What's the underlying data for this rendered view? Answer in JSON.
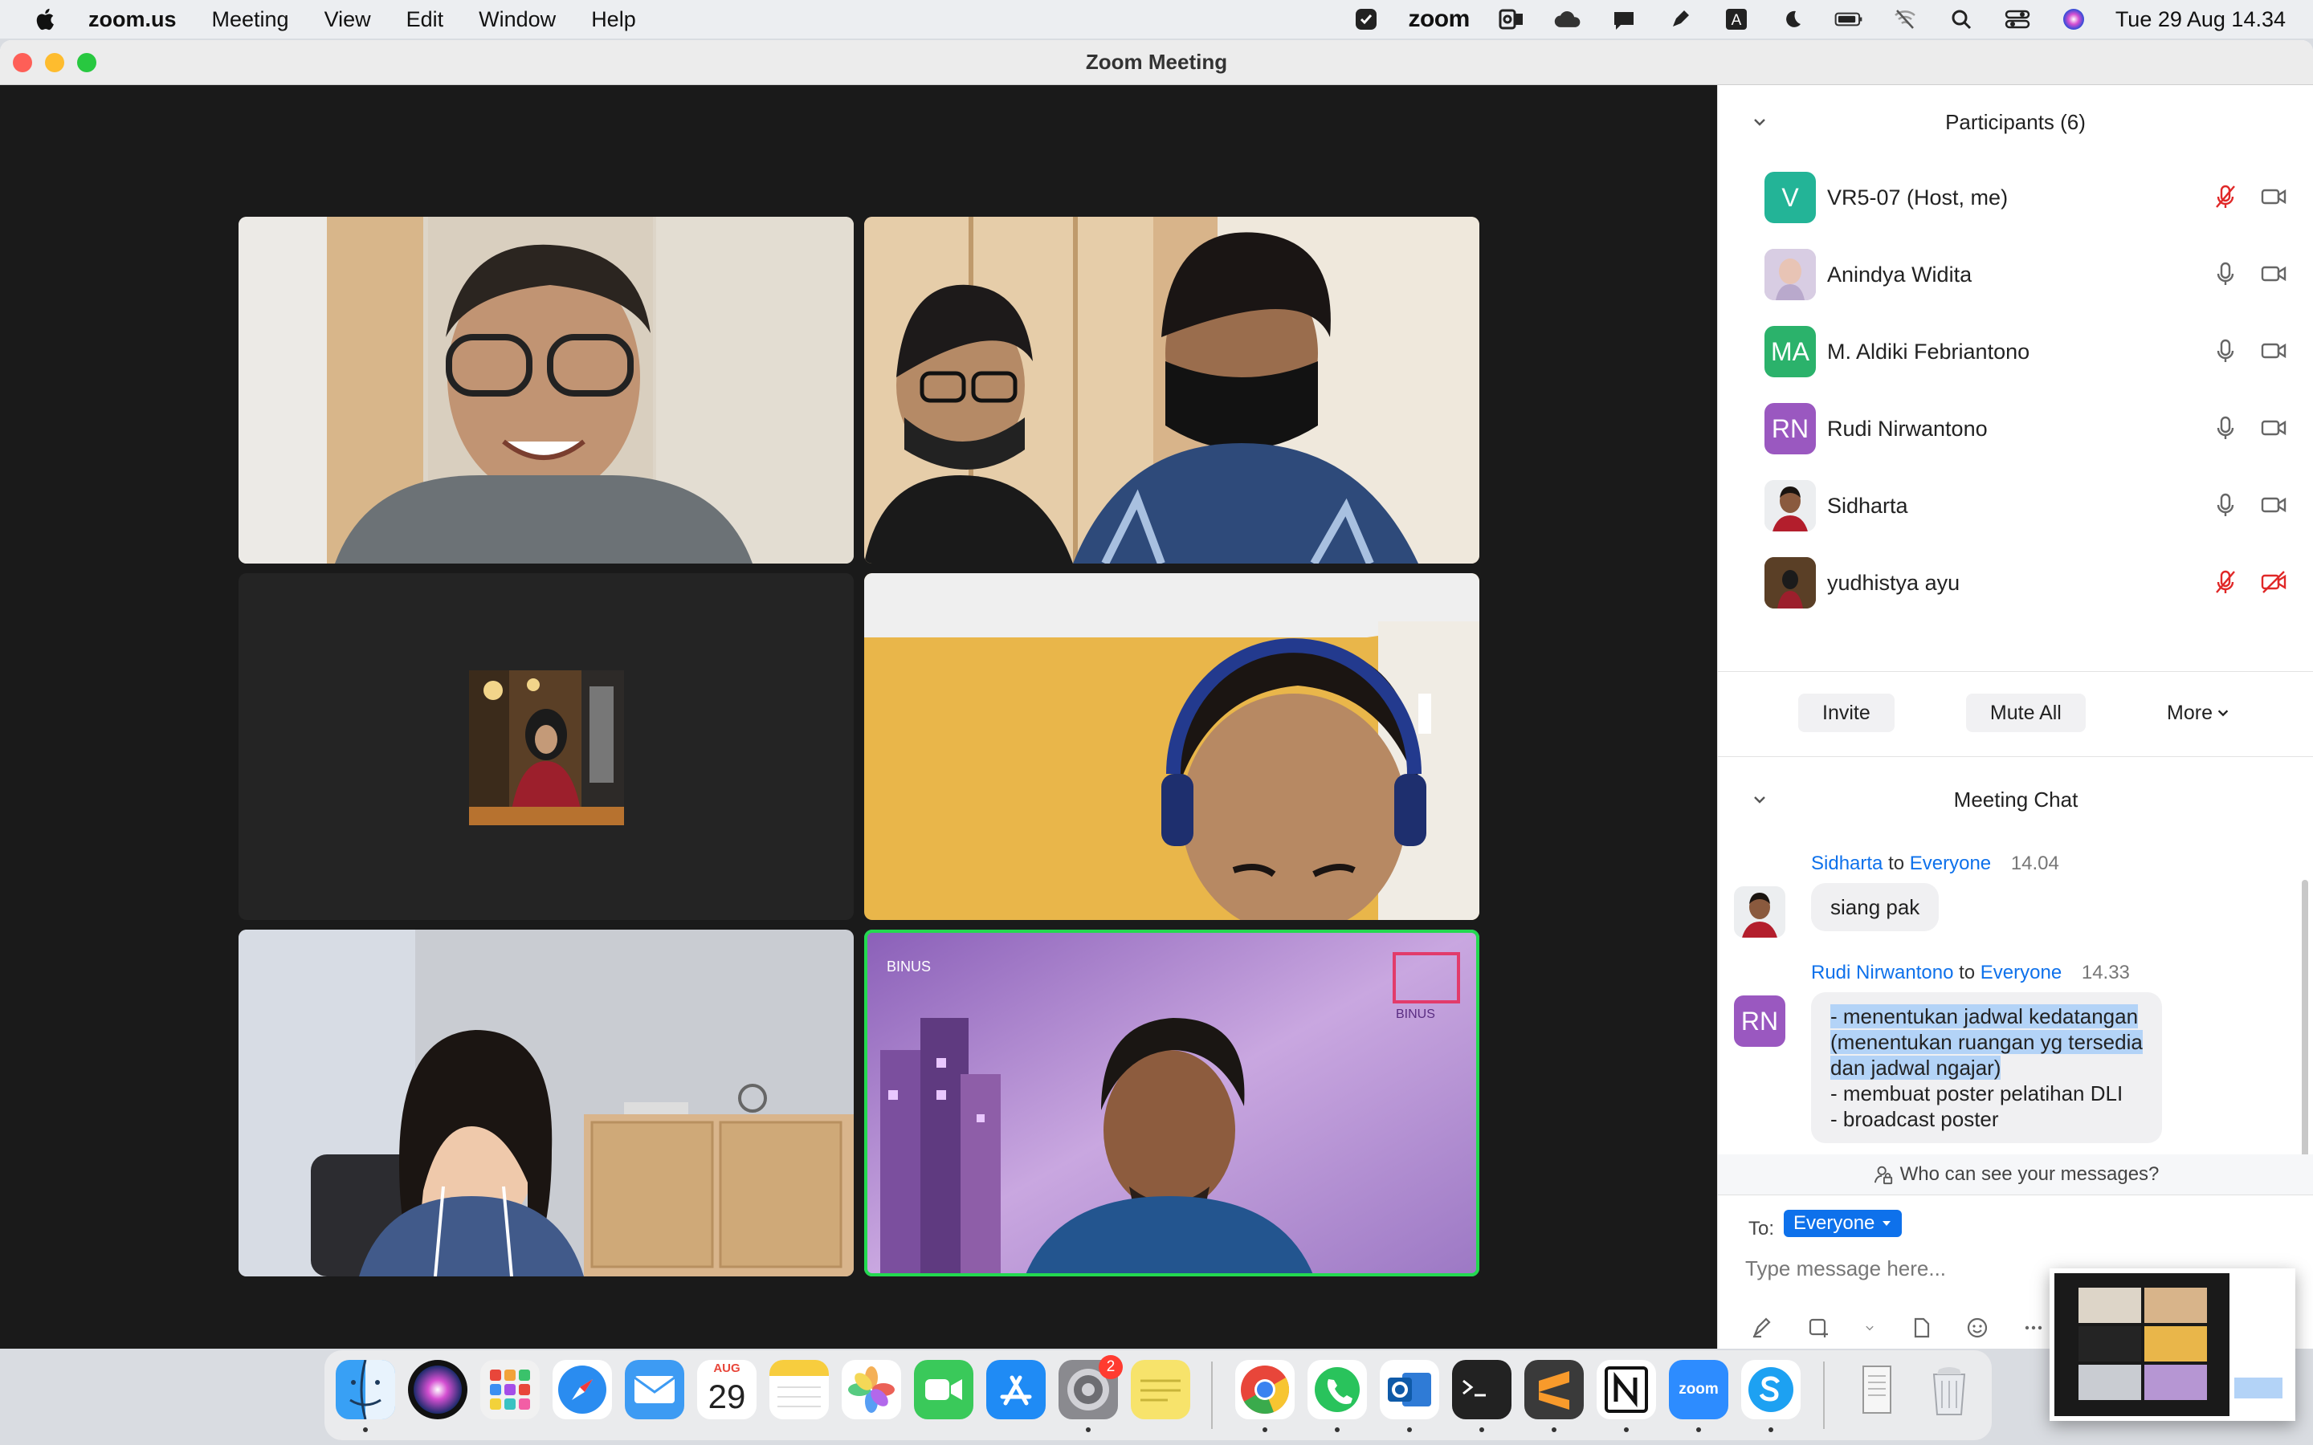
{
  "menubar": {
    "app_name": "zoom.us",
    "menus": [
      "Meeting",
      "View",
      "Edit",
      "Window",
      "Help"
    ],
    "zoom_brand": "zoom",
    "datetime": "Tue 29 Aug  14.34",
    "keyboard_letter": "A"
  },
  "window": {
    "title": "Zoom Meeting"
  },
  "gallery": {
    "active_speaker_color": "#23d950"
  },
  "participants": {
    "header": "Participants (6)",
    "list": [
      {
        "name": "VR5-07 (Host, me)",
        "initials": "V",
        "color": "#23b497",
        "mic": "muted",
        "video": "on"
      },
      {
        "name": "Anindya Widita",
        "initials": "",
        "color": "#cfc4d9",
        "mic": "on",
        "video": "on"
      },
      {
        "name": "M. Aldiki Febriantono",
        "initials": "MA",
        "color": "#2bb26b",
        "mic": "on",
        "video": "on"
      },
      {
        "name": "Rudi Nirwantono",
        "initials": "RN",
        "color": "#9a58c0",
        "mic": "on",
        "video": "on"
      },
      {
        "name": "Sidharta",
        "initials": "",
        "color": "#e9e9ec",
        "mic": "on",
        "video": "on"
      },
      {
        "name": "yudhistya ayu",
        "initials": "",
        "color": "#6b3b2b",
        "mic": "muted",
        "video": "off"
      }
    ],
    "buttons": {
      "invite": "Invite",
      "mute_all": "Mute All",
      "more": "More"
    }
  },
  "chat": {
    "header": "Meeting Chat",
    "messages": [
      {
        "sender": "Sidharta",
        "to_word": "to",
        "recipient": "Everyone",
        "time": "14.04",
        "text": "siang pak"
      },
      {
        "sender": "Rudi Nirwantono",
        "to_word": "to",
        "recipient": "Everyone",
        "time": "14.33",
        "line1": "- menentukan jadwal kedatangan",
        "line2": "(menentukan ruangan yg tersedia",
        "line3": "dan jadwal ngajar)",
        "line4": "- membuat poster pelatihan DLI",
        "line5": "- broadcast poster",
        "avatar_initials": "RN"
      }
    ],
    "who_can_see": "Who can see your messages?",
    "to_label": "To:",
    "to_value": "Everyone",
    "placeholder": "Type message here..."
  },
  "dock": {
    "calendar_month": "AUG",
    "calendar_day": "29",
    "settings_badge": "2",
    "zoom_label": "zoom"
  }
}
